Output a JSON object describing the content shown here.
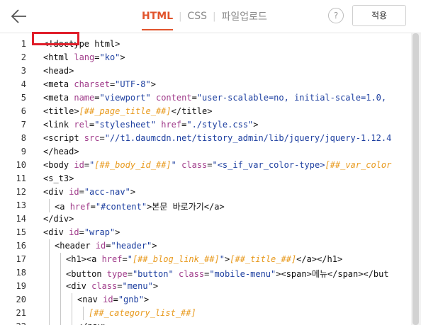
{
  "header": {
    "tabs": [
      {
        "label": "HTML",
        "active": true
      },
      {
        "label": "CSS",
        "active": false
      },
      {
        "label": "파일업로드",
        "active": false
      }
    ],
    "help_label": "?",
    "apply_label": "적용",
    "back_icon": "arrow-left-icon",
    "accent_color": "#e1542c"
  },
  "editor": {
    "highlight_color": "#e01e2a",
    "highlighted_line": 3,
    "lines": [
      {
        "n": "1",
        "tokens": [
          [
            "t",
            "<!doctype html>"
          ]
        ]
      },
      {
        "n": "2",
        "tokens": [
          [
            "t",
            "<html "
          ],
          [
            "a",
            "lang"
          ],
          [
            "t",
            "="
          ],
          [
            "s",
            "\"ko\""
          ],
          [
            "t",
            ">"
          ]
        ]
      },
      {
        "n": "3",
        "tokens": [
          [
            "t",
            "<head>"
          ]
        ]
      },
      {
        "n": "4",
        "tokens": [
          [
            "t",
            "<meta "
          ],
          [
            "a",
            "charset"
          ],
          [
            "t",
            "="
          ],
          [
            "s",
            "\"UTF-8\""
          ],
          [
            "t",
            ">"
          ]
        ]
      },
      {
        "n": "5",
        "tokens": [
          [
            "t",
            "<meta "
          ],
          [
            "a",
            "name"
          ],
          [
            "t",
            "="
          ],
          [
            "s",
            "\"viewport\""
          ],
          [
            "t",
            " "
          ],
          [
            "a",
            "content"
          ],
          [
            "t",
            "="
          ],
          [
            "s",
            "\"user-scalable=no, initial-scale=1.0,"
          ]
        ]
      },
      {
        "n": "6",
        "tokens": [
          [
            "t",
            "<title>"
          ],
          [
            "p",
            "[##_page_title_##]"
          ],
          [
            "t",
            "</title>"
          ]
        ]
      },
      {
        "n": "7",
        "tokens": [
          [
            "t",
            "<link "
          ],
          [
            "a",
            "rel"
          ],
          [
            "t",
            "="
          ],
          [
            "s",
            "\"stylesheet\""
          ],
          [
            "t",
            " "
          ],
          [
            "a",
            "href"
          ],
          [
            "t",
            "="
          ],
          [
            "s",
            "\"./style.css\""
          ],
          [
            "t",
            ">"
          ]
        ]
      },
      {
        "n": "8",
        "tokens": [
          [
            "t",
            "<script "
          ],
          [
            "a",
            "src"
          ],
          [
            "t",
            "="
          ],
          [
            "s",
            "\"//t1.daumcdn.net/tistory_admin/lib/jquery/jquery-1.12.4"
          ]
        ]
      },
      {
        "n": "9",
        "tokens": [
          [
            "t",
            "</head>"
          ]
        ]
      },
      {
        "n": "10",
        "tokens": [
          [
            "t",
            "<body "
          ],
          [
            "a",
            "id"
          ],
          [
            "t",
            "="
          ],
          [
            "s",
            "\""
          ],
          [
            "p",
            "[##_body_id_##]"
          ],
          [
            "s",
            "\""
          ],
          [
            "t",
            " "
          ],
          [
            "a",
            "class"
          ],
          [
            "t",
            "="
          ],
          [
            "s",
            "\"<s_if_var_color-type>"
          ],
          [
            "p",
            "[##_var_color"
          ]
        ]
      },
      {
        "n": "11",
        "tokens": [
          [
            "t",
            "<s_t3>"
          ]
        ]
      },
      {
        "n": "12",
        "tokens": [
          [
            "t",
            "<div "
          ],
          [
            "a",
            "id"
          ],
          [
            "t",
            "="
          ],
          [
            "s",
            "\"acc-nav\""
          ],
          [
            "t",
            ">"
          ]
        ]
      },
      {
        "n": "13",
        "indent": 1,
        "tokens": [
          [
            "t",
            "<a "
          ],
          [
            "a",
            "href"
          ],
          [
            "t",
            "="
          ],
          [
            "s",
            "\"#content\""
          ],
          [
            "t",
            ">본문 바로가기</a>"
          ]
        ]
      },
      {
        "n": "14",
        "tokens": [
          [
            "t",
            "</div>"
          ]
        ]
      },
      {
        "n": "15",
        "tokens": [
          [
            "t",
            "<div "
          ],
          [
            "a",
            "id"
          ],
          [
            "t",
            "="
          ],
          [
            "s",
            "\"wrap\""
          ],
          [
            "t",
            ">"
          ]
        ]
      },
      {
        "n": "16",
        "indent": 1,
        "tokens": [
          [
            "t",
            "<header "
          ],
          [
            "a",
            "id"
          ],
          [
            "t",
            "="
          ],
          [
            "s",
            "\"header\""
          ],
          [
            "t",
            ">"
          ]
        ]
      },
      {
        "n": "17",
        "indent": 2,
        "tokens": [
          [
            "t",
            "<h1><a "
          ],
          [
            "a",
            "href"
          ],
          [
            "t",
            "="
          ],
          [
            "s",
            "\""
          ],
          [
            "p",
            "[##_blog_link_##]"
          ],
          [
            "s",
            "\""
          ],
          [
            "t",
            ">"
          ],
          [
            "p",
            "[##_title_##]"
          ],
          [
            "t",
            "</a></h1>"
          ]
        ]
      },
      {
        "n": "18",
        "indent": 2,
        "tokens": [
          [
            "t",
            "<button "
          ],
          [
            "a",
            "type"
          ],
          [
            "t",
            "="
          ],
          [
            "s",
            "\"button\""
          ],
          [
            "t",
            " "
          ],
          [
            "a",
            "class"
          ],
          [
            "t",
            "="
          ],
          [
            "s",
            "\"mobile-menu\""
          ],
          [
            "t",
            "><span>메뉴</span></but"
          ]
        ]
      },
      {
        "n": "19",
        "indent": 2,
        "tokens": [
          [
            "t",
            "<div "
          ],
          [
            "a",
            "class"
          ],
          [
            "t",
            "="
          ],
          [
            "s",
            "\"menu\""
          ],
          [
            "t",
            ">"
          ]
        ]
      },
      {
        "n": "20",
        "indent": 3,
        "tokens": [
          [
            "t",
            "<nav "
          ],
          [
            "a",
            "id"
          ],
          [
            "t",
            "="
          ],
          [
            "s",
            "\"gnb\""
          ],
          [
            "t",
            ">"
          ]
        ]
      },
      {
        "n": "21",
        "indent": 4,
        "tokens": [
          [
            "p",
            "[##_category_list_##]"
          ]
        ]
      },
      {
        "n": "22",
        "indent": 3,
        "tokens": [
          [
            "t",
            "</nav>"
          ]
        ]
      }
    ]
  }
}
